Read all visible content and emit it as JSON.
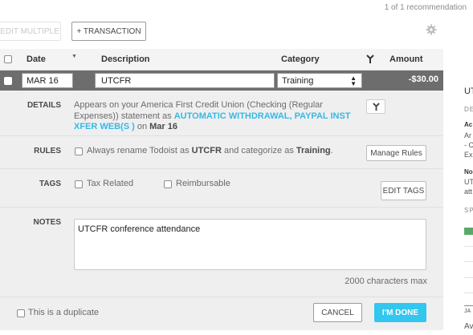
{
  "recommendation_count": "1 of 1 recommendation",
  "toolbar": {
    "edit_multiple": "EDIT MULTIPLE",
    "add_transaction": "+ TRANSACTION",
    "settings_icon": "gear-icon"
  },
  "columns": {
    "date": "Date",
    "description": "Description",
    "category": "Category",
    "amount": "Amount",
    "split_icon": "split-icon"
  },
  "transaction": {
    "date": "MAR 16",
    "description": "UTCFR",
    "category": "Training",
    "amount": "-$30.00"
  },
  "details": {
    "label": "DETAILS",
    "text_1": "Appears on your America First Credit Union (Checking (Regular Expenses)) statement as ",
    "statement_name": "AUTOMATIC WITHDRAWAL, PAYPAL INST XFER WEB(S )",
    "text_2": " on ",
    "statement_date": "Mar 16"
  },
  "rules": {
    "label": "RULES",
    "text_1": "Always rename Todoist as ",
    "rename_to": "UTCFR",
    "text_2": " and categorize as ",
    "category": "Training",
    "text_3": ".",
    "manage_button": "Manage Rules"
  },
  "tags": {
    "label": "TAGS",
    "options": [
      "Tax Related",
      "Reimbursable"
    ],
    "edit_button": "EDIT TAGS"
  },
  "notes": {
    "label": "NOTES",
    "value": "UTCFR conference attendance",
    "limit": "2000 characters max"
  },
  "footer": {
    "duplicate": "This is a duplicate",
    "cancel": "CANCEL",
    "done": "I'M DONE"
  },
  "right_panel": {
    "title": "UT",
    "section": "DE",
    "account_label": "Ac",
    "account_lines": [
      "Ar",
      "- C",
      "Ex"
    ],
    "notes_label": "No",
    "notes_lines": [
      "UT",
      "att"
    ],
    "spending_label": "SP",
    "month": "JA",
    "footer": "Av"
  },
  "colors": {
    "accent": "#33c6ef",
    "link": "#37b8e6",
    "selected_row": "#6d6d6d",
    "detail_bg": "#efefef"
  }
}
